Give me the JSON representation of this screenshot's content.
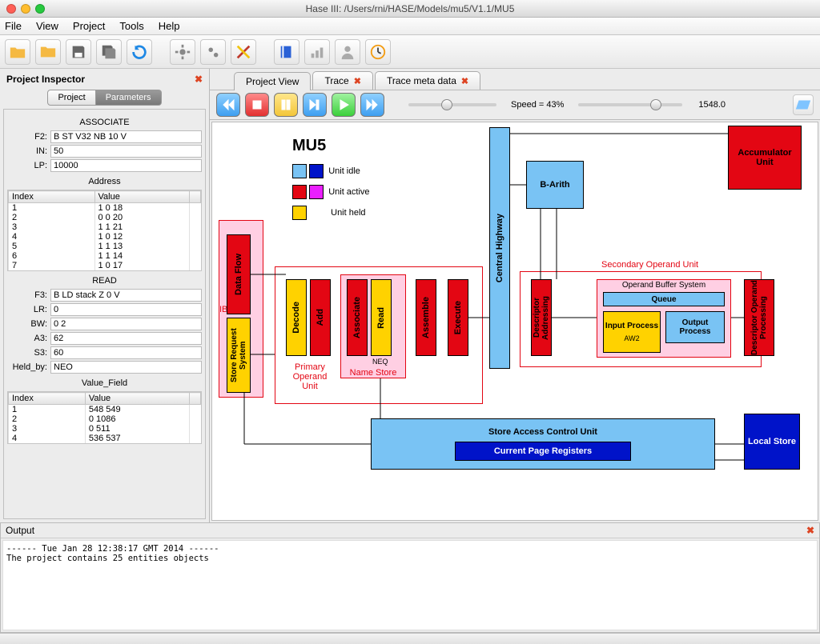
{
  "window": {
    "title": "Hase III: /Users/rni/HASE/Models/mu5/V1.1/MU5"
  },
  "menu": [
    "File",
    "View",
    "Project",
    "Tools",
    "Help"
  ],
  "inspector": {
    "title": "Project Inspector",
    "tabs": [
      "Project",
      "Parameters"
    ],
    "active_tab": 1,
    "associate": {
      "title": "ASSOCIATE",
      "F2": "B ST V32 NB 10 V",
      "IN": "50",
      "LP": "10000",
      "addr_header": "Address",
      "cols": [
        "Index",
        "Value"
      ],
      "rows": [
        [
          "1",
          "1 0 18"
        ],
        [
          "2",
          "0 0 20"
        ],
        [
          "3",
          "1 1 21"
        ],
        [
          "4",
          "1 0 12"
        ],
        [
          "5",
          "1 1 13"
        ],
        [
          "6",
          "1 1 14"
        ],
        [
          "7",
          "1 0 17"
        ]
      ]
    },
    "read": {
      "title": "READ",
      "F3": "B LD stack Z 0 V",
      "LR": "0",
      "BW": "0 2",
      "A3": "62",
      "S3": "60",
      "Held_by": "NEO",
      "vf_header": "Value_Field",
      "cols": [
        "Index",
        "Value"
      ],
      "rows": [
        [
          "1",
          "548 549"
        ],
        [
          "2",
          "0 1086"
        ],
        [
          "3",
          "0 511"
        ],
        [
          "4",
          "536 537"
        ]
      ]
    }
  },
  "tabs": {
    "project_view": "Project View",
    "trace": "Trace",
    "trace_meta": "Trace meta data"
  },
  "playbar": {
    "speed_label": "Speed = 43%",
    "value2": "1548.0"
  },
  "diagram": {
    "title": "MU5",
    "legend": {
      "idle": "Unit idle",
      "active": "Unit active",
      "held": "Unit held"
    },
    "ibu": "IBU",
    "data_flow": "Data Flow",
    "srs": "Store Request System",
    "decode": "Decode",
    "add": "Add",
    "associate": "Associate",
    "readu": "Read",
    "assemble": "Assemble",
    "execute": "Execute",
    "neq": "NEQ",
    "name_store": "Name Store",
    "pou": "Primary Operand Unit",
    "ch": "Central Highway",
    "barith": "B-Arith",
    "acc": "Accumulator Unit",
    "sou": "Secondary Operand Unit",
    "da": "Descriptor Addressing",
    "obs": "Operand Buffer System",
    "queue": "Queue",
    "inproc": "Input Process",
    "aw2": "AW2",
    "outproc": "Output Process",
    "dop": "Descriptor Operand Processing",
    "sacu": "Store Access Control Unit",
    "cpr": "Current Page Registers",
    "local_store": "Local Store"
  },
  "output": {
    "title": "Output",
    "text": "------ Tue Jan 28 12:38:17 GMT 2014 ------\nThe project contains 25 entities objects"
  }
}
